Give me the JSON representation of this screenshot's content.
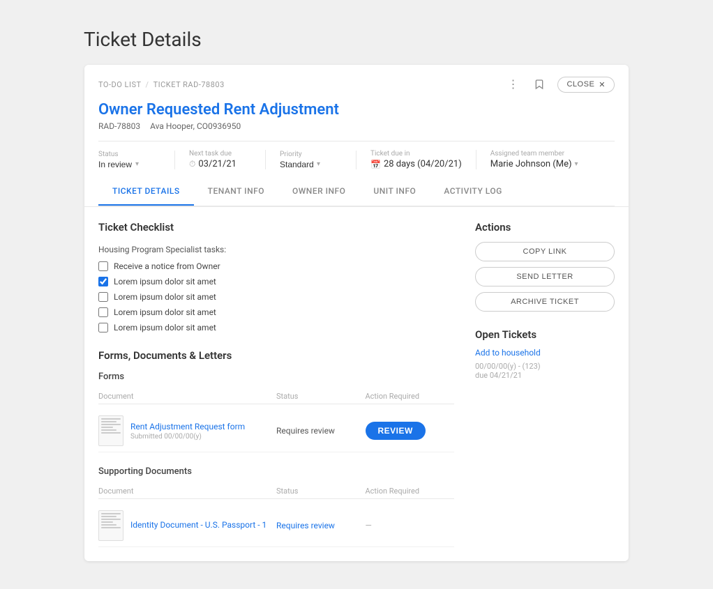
{
  "page": {
    "title": "Ticket Details"
  },
  "breadcrumb": {
    "parent": "TO-DO LIST",
    "current": "TICKET RAD-78803"
  },
  "header": {
    "ticket_title": "Owner Requested Rent Adjustment",
    "ticket_id": "RAD-78803",
    "tenant": "Ava Hooper, CO0936950",
    "close_label": "CLOSE",
    "more_icon": "⋮",
    "bookmark_icon": "🔖"
  },
  "fields": {
    "status_label": "Status",
    "status_value": "In review",
    "next_task_label": "Next task due",
    "next_task_value": "03/21/21",
    "priority_label": "Priority",
    "priority_value": "Standard",
    "ticket_due_label": "Ticket due in",
    "ticket_due_value": "28 days (04/20/21)",
    "assignee_label": "Assigned team member",
    "assignee_value": "Marie Johnson (Me)"
  },
  "tabs": [
    {
      "label": "TICKET DETAILS",
      "active": true
    },
    {
      "label": "TENANT INFO",
      "active": false
    },
    {
      "label": "OWNER INFO",
      "active": false
    },
    {
      "label": "UNIT INFO",
      "active": false
    },
    {
      "label": "ACTIVITY LOG",
      "active": false
    }
  ],
  "checklist": {
    "title": "Ticket Checklist",
    "subtitle": "Housing Program Specialist tasks:",
    "items": [
      {
        "label": "Receive a notice from Owner",
        "checked": false
      },
      {
        "label": "Lorem ipsum dolor sit amet",
        "checked": true
      },
      {
        "label": "Lorem ipsum dolor sit amet",
        "checked": false
      },
      {
        "label": "Lorem ipsum dolor sit amet",
        "checked": false
      },
      {
        "label": "Lorem ipsum dolor sit amet",
        "checked": false
      }
    ]
  },
  "forms_section": {
    "title": "Forms, Documents & Letters",
    "forms_subtitle": "Forms",
    "table_headers": {
      "document": "Document",
      "status": "Status",
      "action_required": "Action required"
    },
    "forms": [
      {
        "name": "Rent Adjustment Request form",
        "submitted": "Submitted 00/00/00(y)",
        "status": "Requires review",
        "action": "REVIEW",
        "action_type": "button"
      }
    ]
  },
  "supporting_docs": {
    "title": "Supporting Documents",
    "table_headers": {
      "document": "Document",
      "status": "Status",
      "action_required": "Action required"
    },
    "docs": [
      {
        "name": "Identity Document - U.S. Passport - 1",
        "status": "Requires review",
        "action": "—",
        "action_type": "dash"
      }
    ]
  },
  "actions": {
    "title": "Actions",
    "copy_link": "COPY LINK",
    "send_letter": "SEND LETTER",
    "archive_ticket": "ARCHIVE TICKET"
  },
  "open_tickets": {
    "title": "Open Tickets",
    "add_label": "Add to household",
    "ticket_mini_line1": "00/00/00(y) - (123)",
    "ticket_mini_line2": "due 04/21/21"
  }
}
